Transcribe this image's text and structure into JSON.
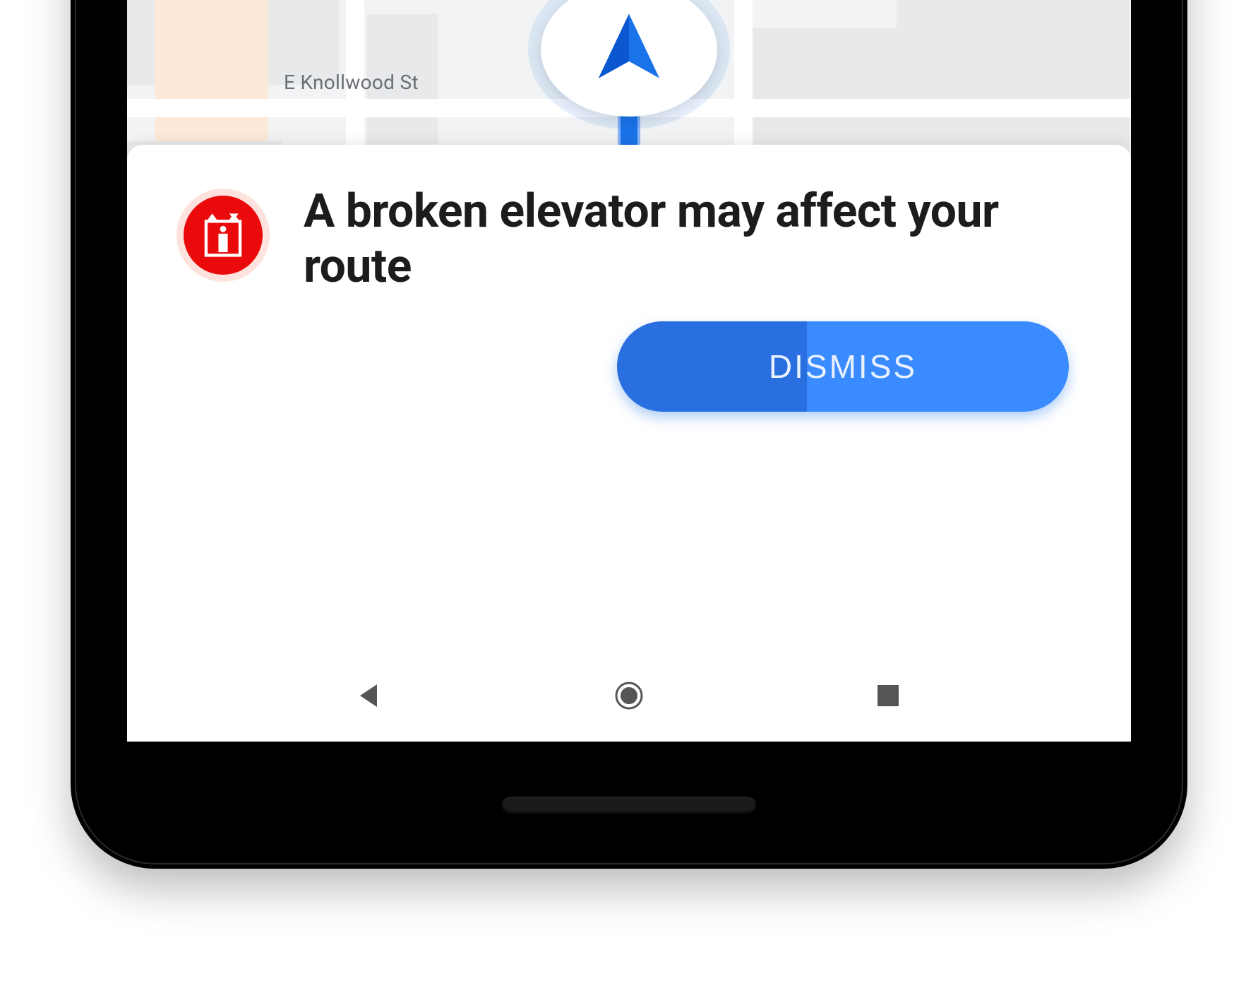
{
  "map": {
    "street_label": "E Knollwood St"
  },
  "alert": {
    "title": "A broken elevator may affect your route",
    "dismiss_label": "DISMISS",
    "icon_name": "elevator-broken-icon"
  },
  "nav": {
    "back": "Back",
    "home": "Home",
    "recent": "Recent apps"
  },
  "colors": {
    "route": "#1a73e8",
    "alert_red": "#ea0a0c",
    "button_blue": "#3a8bff"
  }
}
